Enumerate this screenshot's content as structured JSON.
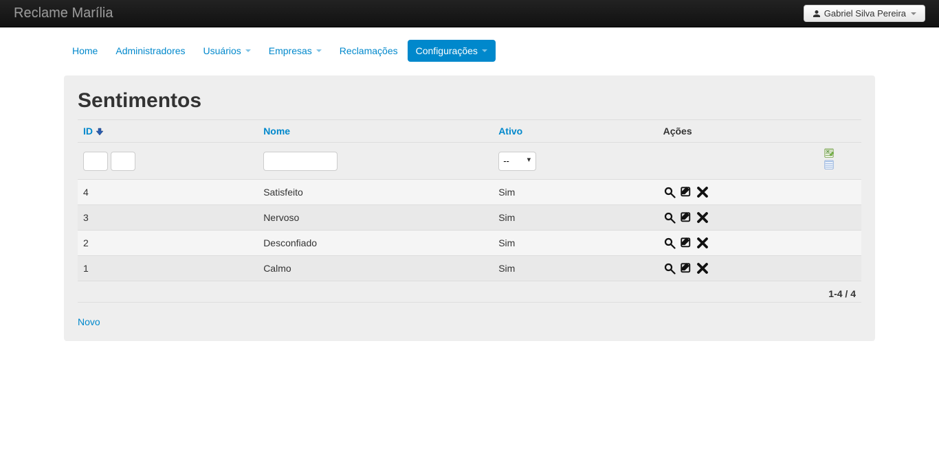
{
  "navbar": {
    "brand": "Reclame Marília",
    "user_name": "Gabriel Silva Pereira"
  },
  "nav": {
    "home": "Home",
    "administradores": "Administradores",
    "usuarios": "Usuários",
    "empresas": "Empresas",
    "reclamacoes": "Reclamações",
    "configuracoes": "Configurações"
  },
  "page": {
    "title": "Sentimentos"
  },
  "table": {
    "headers": {
      "id": "ID",
      "nome": "Nome",
      "ativo": "Ativo",
      "acoes": "Ações"
    },
    "filter": {
      "ativo_selected": "--"
    },
    "rows": [
      {
        "id": "4",
        "nome": "Satisfeito",
        "ativo": "Sim"
      },
      {
        "id": "3",
        "nome": "Nervoso",
        "ativo": "Sim"
      },
      {
        "id": "2",
        "nome": "Desconfiado",
        "ativo": "Sim"
      },
      {
        "id": "1",
        "nome": "Calmo",
        "ativo": "Sim"
      }
    ],
    "footer": "1-4 / 4",
    "new_link": "Novo"
  }
}
